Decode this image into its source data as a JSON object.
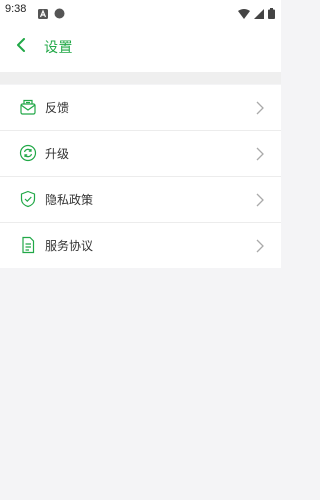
{
  "status_bar": {
    "time": "9:38",
    "left_icons": [
      "a-app-icon",
      "dot-icon"
    ],
    "right_icons": [
      "wifi-icon",
      "signal-icon",
      "battery-icon"
    ]
  },
  "header": {
    "title": "设置",
    "back_icon": "chevron-left-icon"
  },
  "colors": {
    "accent": "#21a847",
    "background": "#f4f4f6",
    "text": "#333333"
  },
  "settings": {
    "items": [
      {
        "label": "反馈",
        "icon": "feedback-mail-icon"
      },
      {
        "label": "升级",
        "icon": "refresh-upgrade-icon"
      },
      {
        "label": "隐私政策",
        "icon": "shield-check-icon"
      },
      {
        "label": "服务协议",
        "icon": "document-icon"
      }
    ]
  }
}
